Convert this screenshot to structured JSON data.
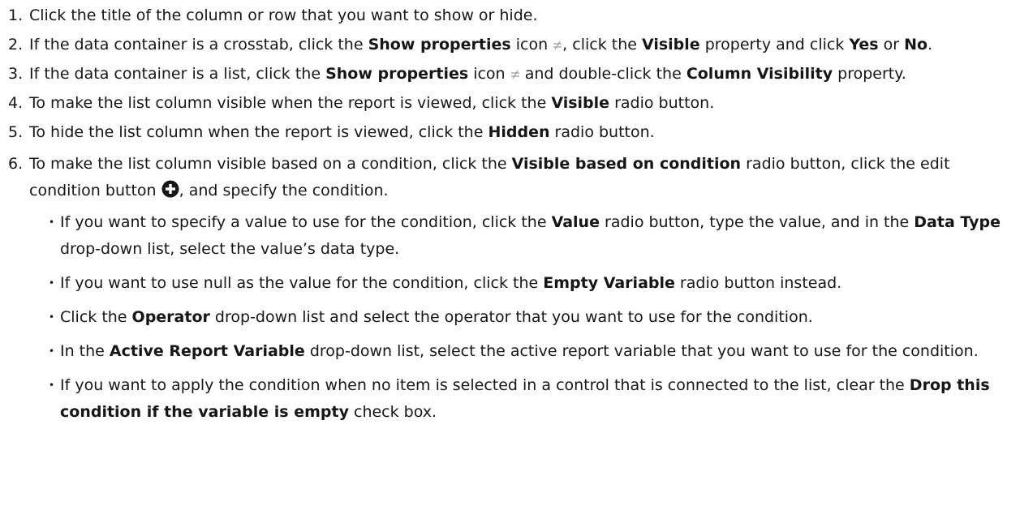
{
  "steps": [
    {
      "num": "1.",
      "text": "Click the title of the column or row that you want to show or hide."
    },
    {
      "num": "2.",
      "p1": "If the data container is a crosstab, click the ",
      "b1": "Show properties",
      "p2": " icon ",
      "p3": ", click the ",
      "b2": "Visible",
      "p4": " property and click ",
      "b3": "Yes",
      "p5": " or ",
      "b4": "No",
      "p6": "."
    },
    {
      "num": "3.",
      "p1": "If the data container is a list, click the ",
      "b1": "Show properties",
      "p2": " icon ",
      "p3": " and double-click the ",
      "b2": "Column Visibility",
      "p4": " property."
    },
    {
      "num": "4.",
      "p1": "To make the list column visible when the report is viewed, click the ",
      "b1": "Visible",
      "p2": " radio button."
    },
    {
      "num": "5.",
      "p1": "To hide the list column when the report is viewed, click the ",
      "b1": "Hidden",
      "p2": " radio button."
    },
    {
      "num": "6.",
      "p1": "To make the list column visible based on a condition, click the ",
      "b1": "Visible based on condition",
      "p2": " radio button, click the edit condition button ",
      "p3": ", and specify the condition."
    }
  ],
  "bullets": [
    {
      "p1": "If you want to specify a value to use for the condition, click the ",
      "b1": "Value",
      "p2": " radio button, type the value, and in the ",
      "b2": "Data Type",
      "p3": " drop-down list, select the value’s data type."
    },
    {
      "p1": "If you want to use null as the value for the condition, click the ",
      "b1": "Empty Variable",
      "p2": " radio button instead."
    },
    {
      "p1": "Click the ",
      "b1": "Operator",
      "p2": " drop-down list and select the operator that you want to use for the condition."
    },
    {
      "p1": "In the ",
      "b1": "Active Report Variable",
      "p2": " drop-down list, select the active report variable that you want to use for the condition."
    },
    {
      "p1": "If you want to apply the condition when no item is selected in a control that is connected to the list, clear the ",
      "b1": "Drop this condition if the variable is empty",
      "p2": " check box."
    }
  ],
  "bullet_char": "•",
  "icons": {
    "show_properties": "show-properties-icon",
    "edit_condition": "add-circle-icon"
  },
  "colors": {
    "text": "#161616",
    "icon_light": "#9a9a9a"
  }
}
